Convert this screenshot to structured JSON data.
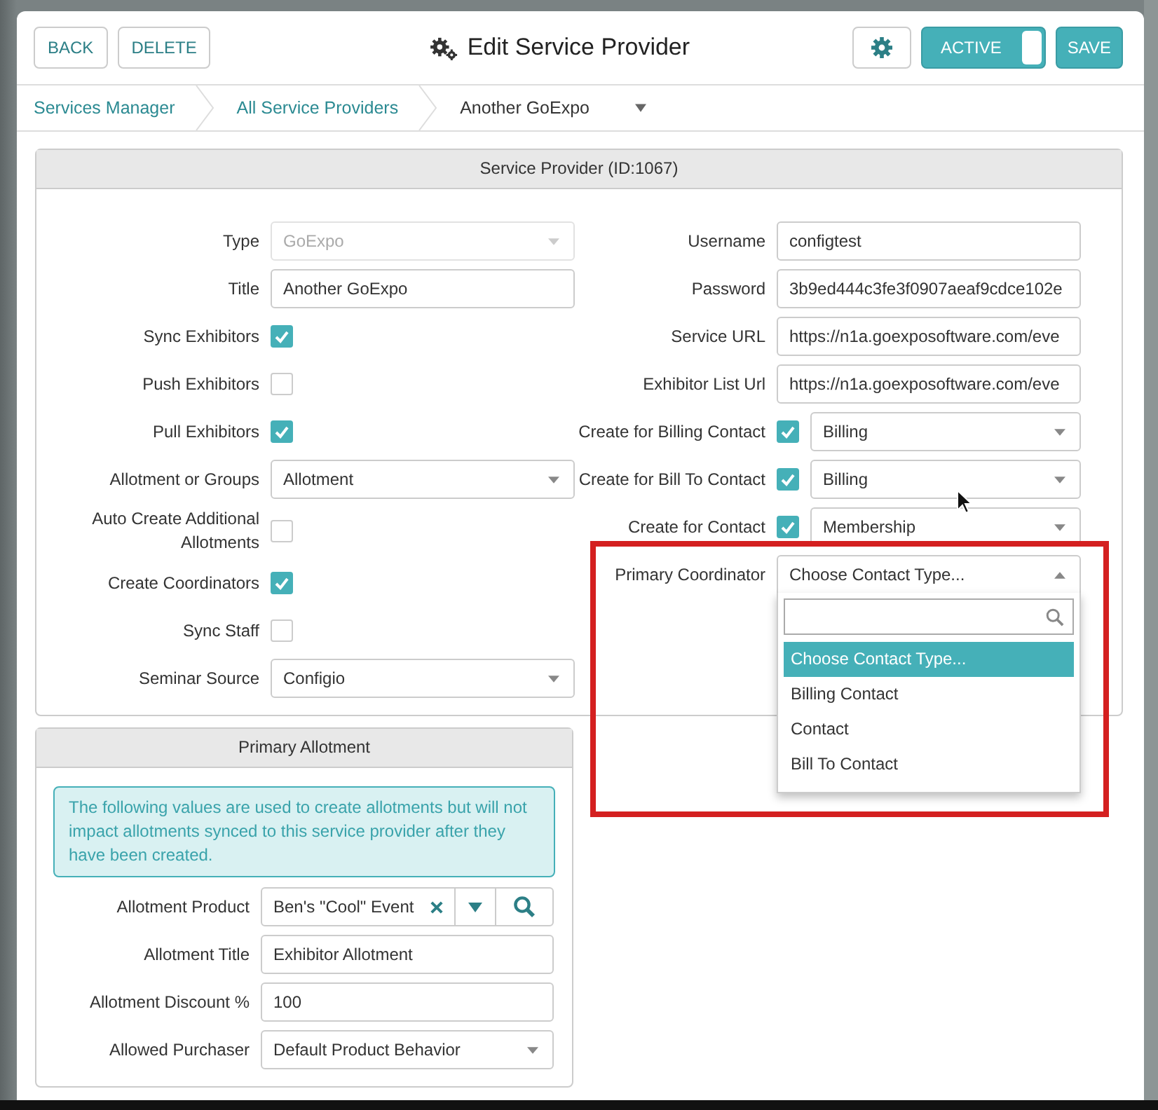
{
  "header": {
    "buttons": [
      "BACK",
      "DELETE"
    ],
    "title": "Edit Service Provider",
    "status_toggle": {
      "label": "ACTIVE",
      "on": true
    },
    "save_button": "SAVE"
  },
  "breadcrumbs": [
    {
      "label": "Services Manager",
      "kind": "link"
    },
    {
      "label": "All Service Providers",
      "kind": "link"
    },
    {
      "label": "Another GoExpo",
      "kind": "current"
    }
  ],
  "service_provider": {
    "title": "Service Provider (ID:1067)",
    "left_fields": [
      {
        "kind": "select",
        "label": "Type",
        "value": "GoExpo",
        "disabled": true
      },
      {
        "kind": "text",
        "label": "Title",
        "value": "Another GoExpo"
      },
      {
        "kind": "checkbox",
        "label": "Sync Exhibitors",
        "checked": true
      },
      {
        "kind": "checkbox",
        "label": "Push Exhibitors",
        "checked": false
      },
      {
        "kind": "checkbox",
        "label": "Pull Exhibitors",
        "checked": true
      },
      {
        "kind": "select",
        "label": "Allotment or Groups",
        "value": "Allotment",
        "disabled": false
      },
      {
        "kind": "checkbox",
        "label": "Auto Create Additional Allotments",
        "checked": false
      },
      {
        "kind": "checkbox",
        "label": "Create Coordinators",
        "checked": true
      },
      {
        "kind": "checkbox",
        "label": "Sync Staff",
        "checked": false
      },
      {
        "kind": "select",
        "label": "Seminar Source",
        "value": "Configio",
        "disabled": false
      }
    ],
    "right_fields": [
      {
        "kind": "text",
        "label": "Username",
        "value": "configtest"
      },
      {
        "kind": "text",
        "label": "Password",
        "value": "3b9ed444c3fe3f0907aeaf9cdce102e"
      },
      {
        "kind": "text",
        "label": "Service URL",
        "value": "https://n1a.goexposoftware.com/eve"
      },
      {
        "kind": "text",
        "label": "Exhibitor List Url",
        "value": "https://n1a.goexposoftware.com/eve"
      },
      {
        "kind": "check_select",
        "label": "Create for Billing Contact",
        "checked": true,
        "value": "Billing"
      },
      {
        "kind": "check_select",
        "label": "Create for Bill To Contact",
        "checked": true,
        "value": "Billing"
      },
      {
        "kind": "check_select",
        "label": "Create for Contact",
        "checked": true,
        "value": "Membership"
      }
    ],
    "primary_coordinator": {
      "label": "Primary Coordinator",
      "value": "Choose Contact Type...",
      "expanded": true,
      "highlighted": true,
      "options": [
        {
          "label": "Choose Contact Type...",
          "selected": true
        },
        {
          "label": "Billing Contact",
          "selected": false
        },
        {
          "label": "Contact",
          "selected": false
        },
        {
          "label": "Bill To Contact",
          "selected": false
        }
      ]
    }
  },
  "primary_allotment": {
    "title": "Primary Allotment",
    "notice": "The following values are used to create allotments but will not impact allotments synced to this service provider after they have been created.",
    "fields": [
      {
        "kind": "product",
        "label": "Allotment Product",
        "value": "Ben's \"Cool\" Event"
      },
      {
        "kind": "text",
        "label": "Allotment Title",
        "value": "Exhibitor Allotment"
      },
      {
        "kind": "text",
        "label": "Allotment Discount %",
        "value": "100"
      },
      {
        "kind": "select",
        "label": "Allowed Purchaser",
        "value": "Default Product Behavior",
        "disabled": false
      }
    ]
  }
}
